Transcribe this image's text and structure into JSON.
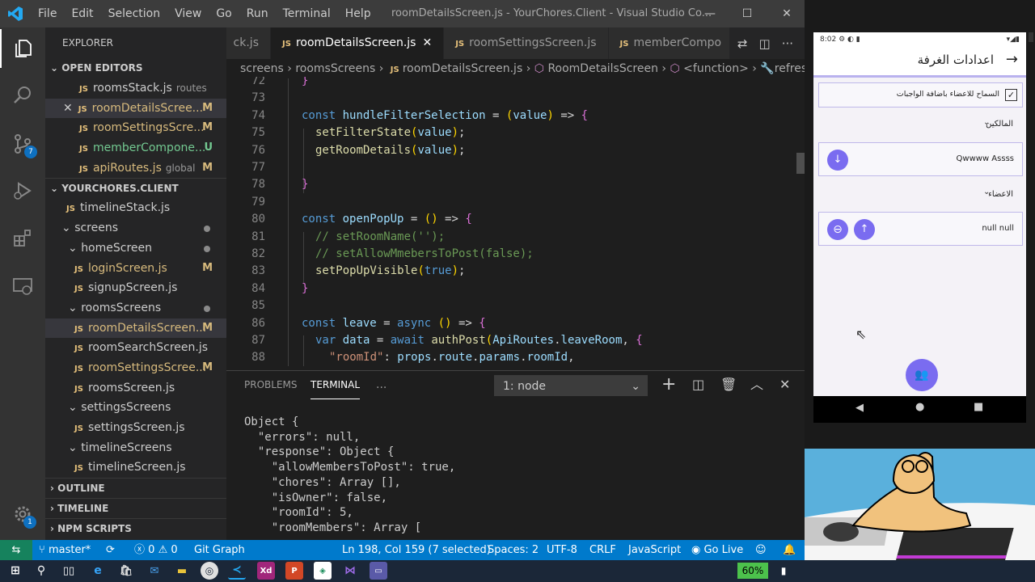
{
  "window": {
    "title": "roomDetailsScreen.js - YourChores.Client - Visual Studio Co..."
  },
  "menu": [
    "File",
    "Edit",
    "Selection",
    "View",
    "Go",
    "Run",
    "Terminal",
    "Help"
  ],
  "activity": {
    "scm_badge": "7",
    "settings_badge": "1"
  },
  "sidebar": {
    "header": "EXPLORER",
    "open_editors_title": "OPEN EDITORS",
    "open_editors": [
      {
        "name": "roomsStack.js",
        "desc": "routes",
        "status": ""
      },
      {
        "name": "roomDetailsScree...",
        "desc": "",
        "status": "M"
      },
      {
        "name": "roomSettingsScre...",
        "desc": "",
        "status": "M"
      },
      {
        "name": "memberCompone...",
        "desc": "",
        "status": "U"
      },
      {
        "name": "apiRoutes.js",
        "desc": "global",
        "status": "M"
      }
    ],
    "project_title": "YOURCHORES.CLIENT",
    "tree": [
      {
        "label": "timelineStack.js",
        "status": ""
      },
      {
        "label": "screens",
        "status": ""
      },
      {
        "label": "homeScreen",
        "status": ""
      },
      {
        "label": "loginScreen.js",
        "status": "M"
      },
      {
        "label": "signupScreen.js",
        "status": ""
      },
      {
        "label": "roomsScreens",
        "status": ""
      },
      {
        "label": "roomDetailsScreen...",
        "status": "M"
      },
      {
        "label": "roomSearchScreen.js",
        "status": ""
      },
      {
        "label": "roomSettingsScree...",
        "status": "M"
      },
      {
        "label": "roomsScreen.js",
        "status": ""
      },
      {
        "label": "settingsScreens",
        "status": ""
      },
      {
        "label": "settingsScreen.js",
        "status": ""
      },
      {
        "label": "timelineScreens",
        "status": ""
      },
      {
        "label": "timelineScreen.js",
        "status": ""
      }
    ],
    "outline": "OUTLINE",
    "timeline": "TIMELINE",
    "npm": "NPM SCRIPTS"
  },
  "tabs": [
    {
      "label": "ck.js"
    },
    {
      "label": "roomDetailsScreen.js"
    },
    {
      "label": "roomSettingsScreen.js"
    },
    {
      "label": "memberCompo"
    }
  ],
  "breadcrumb": {
    "a": "screens",
    "b": "roomsScreens",
    "c": "roomDetailsScreen.js",
    "d": "RoomDetailsScreen",
    "e": "<function>",
    "f": "refresh"
  },
  "editor": {
    "line_numbers": [
      "72",
      "73",
      "74",
      "75",
      "76",
      "77",
      "78",
      "79",
      "80",
      "81",
      "82",
      "83",
      "84",
      "85",
      "86",
      "87",
      "88"
    ],
    "code_text": [
      "}",
      "",
      "const hundleFilterSelection = (value) => {",
      "setFilterState(value);",
      "getRoomDetails(value);",
      "",
      "}",
      "",
      "const openPopUp = () => {",
      "// setRoomName('');",
      "// setAllowMmebersToPost(false);",
      "setPopUpVisible(true);",
      "}",
      "",
      "const leave = async () => {",
      "var data = await authPost(ApiRoutes.leaveRoom, {",
      "\"roomId\": props.route.params.roomId,"
    ]
  },
  "panel": {
    "problems": "PROBLEMS",
    "terminal": "TERMINAL",
    "more": "...",
    "term_select": "1: node"
  },
  "terminal_lines": [
    "Object {",
    "  \"errors\": null,",
    "  \"response\": Object {",
    "    \"allowMembersToPost\": true,",
    "    \"chores\": Array [],",
    "    \"isOwner\": false,",
    "    \"roomId\": 5,",
    "    \"roomMembers\": Array ["
  ],
  "statusbar": {
    "branch": "master*",
    "errors": "0",
    "warnings": "0",
    "git_graph": "Git Graph",
    "position": "Ln 198, Col 159 (7 selected)",
    "spaces": "Spaces: 2",
    "encoding": "UTF-8",
    "eol": "CRLF",
    "language": "JavaScript",
    "golive": "Go Live"
  },
  "phone": {
    "time": "8:02",
    "title": "اعدادات الغرفة",
    "checkbox_label": "السماح للاعضاء باضافة الواجبات",
    "owners_label": "المالكين",
    "owner_name": "Qwwww Assss",
    "members_label": "الاعضاء",
    "member_name": "null null"
  },
  "taskbar": {
    "battery": "60%"
  },
  "colors": {
    "accent": "#007acc",
    "phone_purple": "#7a6cf0"
  }
}
